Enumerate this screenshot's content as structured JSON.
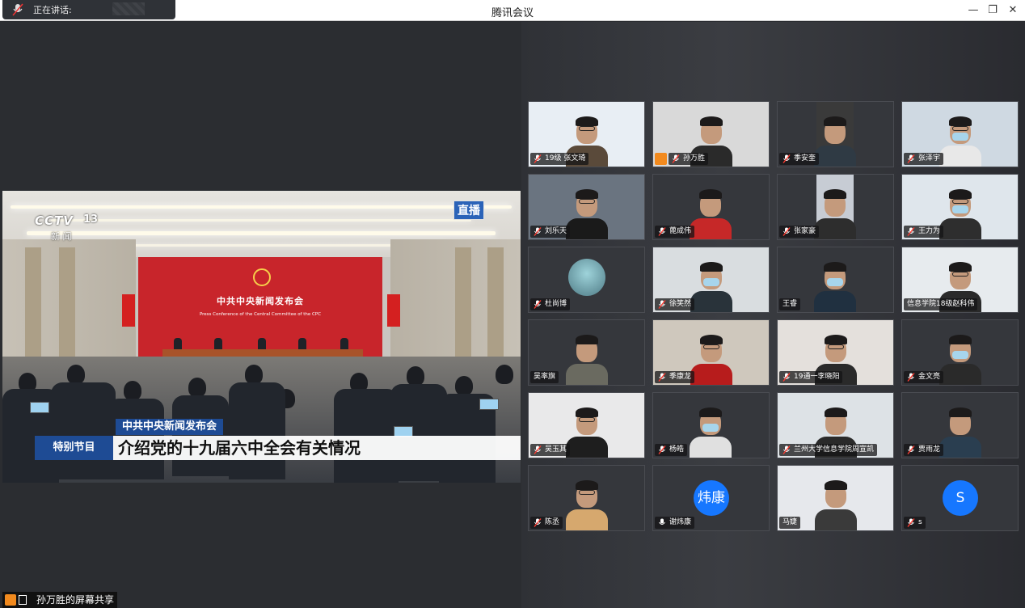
{
  "window": {
    "title": "腾讯会议",
    "speaking_label": "正在讲话:"
  },
  "share": {
    "channel_logo": "CCTV",
    "channel_number": "13",
    "channel_sub": "新 闻",
    "live_badge": "直播",
    "backdrop_title": "中共中央新闻发布会",
    "backdrop_subtitle": "Press Conference of the Central Committee of the CPC",
    "lower_third_small": "中共中央新闻发布会",
    "lower_third_tag": "特别节目",
    "lower_third_headline": "介绍党的十九届六中全会有关情况",
    "sharer_label": "孙万胜的屏幕共享"
  },
  "participants": [
    {
      "name": "19级 张文琦",
      "type": "video",
      "mic": "muted"
    },
    {
      "name": "孙万胜",
      "type": "video",
      "mic": "muted",
      "host": true
    },
    {
      "name": "季安奎",
      "type": "video",
      "mic": "muted"
    },
    {
      "name": "张泽宇",
      "type": "video",
      "mic": "muted"
    },
    {
      "name": "刘乐天",
      "type": "video",
      "mic": "muted"
    },
    {
      "name": "蓖成伟",
      "type": "video",
      "mic": "muted"
    },
    {
      "name": "张家豪",
      "type": "video",
      "mic": "muted"
    },
    {
      "name": "王力为",
      "type": "video",
      "mic": "muted"
    },
    {
      "name": "杜尚博",
      "type": "image-avatar",
      "mic": "muted"
    },
    {
      "name": "徐笑然",
      "type": "video",
      "mic": "muted"
    },
    {
      "name": "王睿",
      "type": "video",
      "mic": "none"
    },
    {
      "name": "信息学院18级赵科伟",
      "type": "video",
      "mic": "none"
    },
    {
      "name": "吴率旗",
      "type": "video",
      "mic": "none"
    },
    {
      "name": "季康龙",
      "type": "video",
      "mic": "muted"
    },
    {
      "name": "19通一李晓阳",
      "type": "video",
      "mic": "muted"
    },
    {
      "name": "金文亮",
      "type": "video",
      "mic": "muted"
    },
    {
      "name": "吴玉其",
      "type": "video",
      "mic": "muted"
    },
    {
      "name": "杨皓",
      "type": "video",
      "mic": "muted"
    },
    {
      "name": "兰州大学信息学院周宣凯",
      "type": "video",
      "mic": "muted"
    },
    {
      "name": "贾雨龙",
      "type": "video",
      "mic": "muted"
    },
    {
      "name": "陈丞",
      "type": "video",
      "mic": "muted"
    },
    {
      "name": "谢炜康",
      "type": "avatar",
      "avatar_text": "炜康",
      "mic": "on"
    },
    {
      "name": "马婕",
      "type": "video",
      "mic": "none"
    },
    {
      "name": "s",
      "type": "avatar",
      "avatar_text": "S",
      "mic": "muted"
    }
  ]
}
